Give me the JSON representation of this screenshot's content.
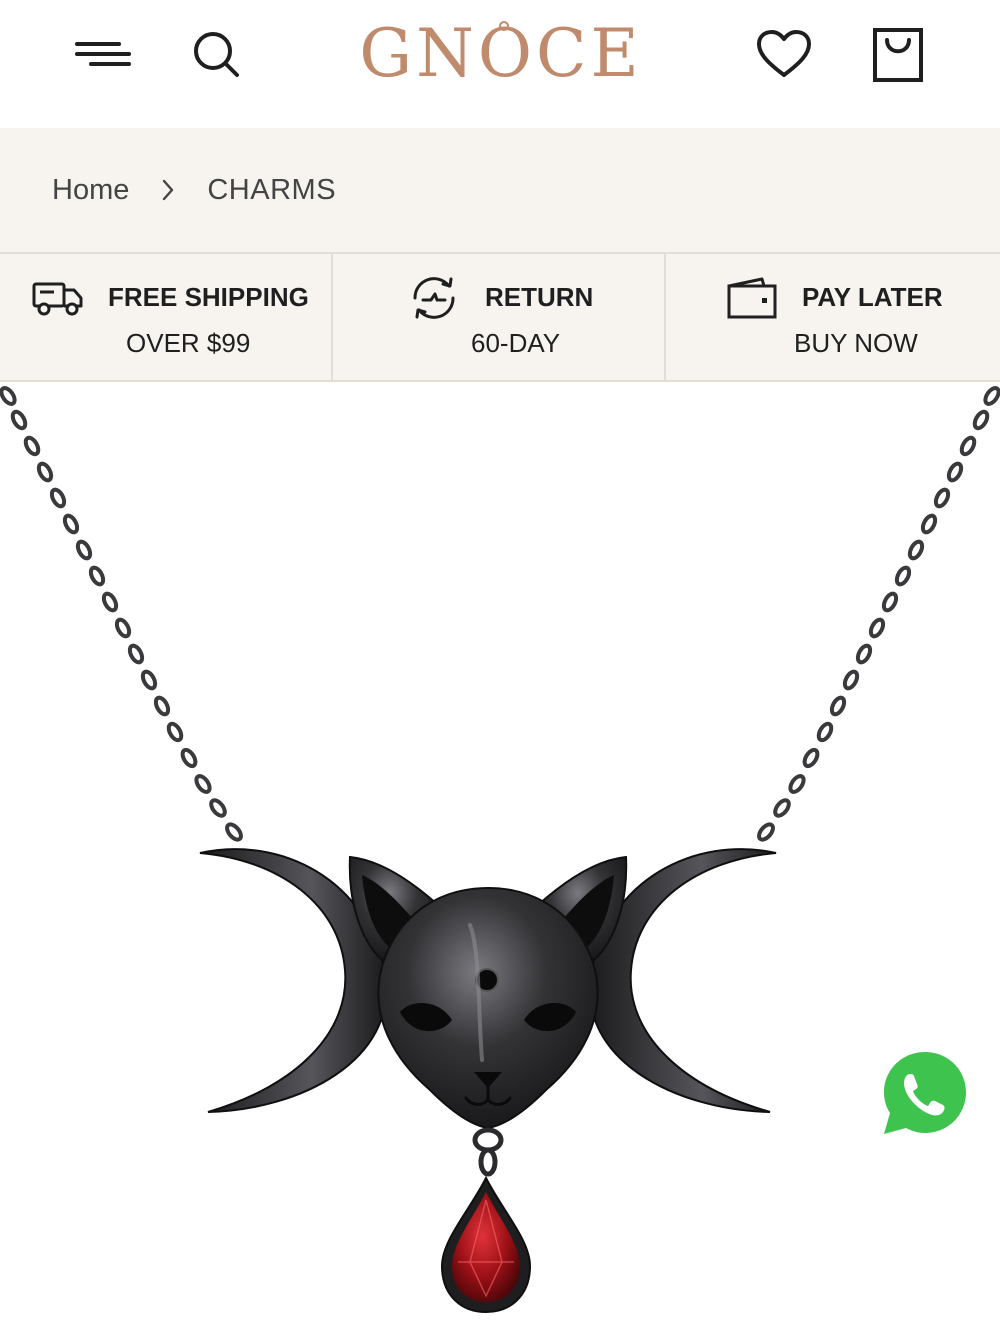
{
  "header": {
    "logo_text": "GNOCE",
    "menu_icon": "menu-icon",
    "search_icon": "search-icon",
    "wishlist_icon": "heart-icon",
    "cart_icon": "shopping-bag-icon",
    "brand_color": "#c08a6c"
  },
  "breadcrumb": {
    "home": "Home",
    "separator_icon": "chevron-right-icon",
    "current": "CHARMS"
  },
  "features": [
    {
      "icon": "truck-icon",
      "title": "FREE SHIPPING",
      "subtitle": "OVER $99"
    },
    {
      "icon": "return-icon",
      "title": "RETURN",
      "subtitle": "60-DAY"
    },
    {
      "icon": "wallet-icon",
      "title": "PAY LATER",
      "subtitle": "BUY NOW"
    }
  ],
  "product": {
    "image_icon": "product-image",
    "gem_color": "#8b0f12",
    "metal_color": "#2b2b2e"
  },
  "chat": {
    "icon": "whatsapp-icon",
    "color": "#3fc34f"
  },
  "colors": {
    "bar_background": "#f7f4f0",
    "divider": "#e2ddd6"
  }
}
